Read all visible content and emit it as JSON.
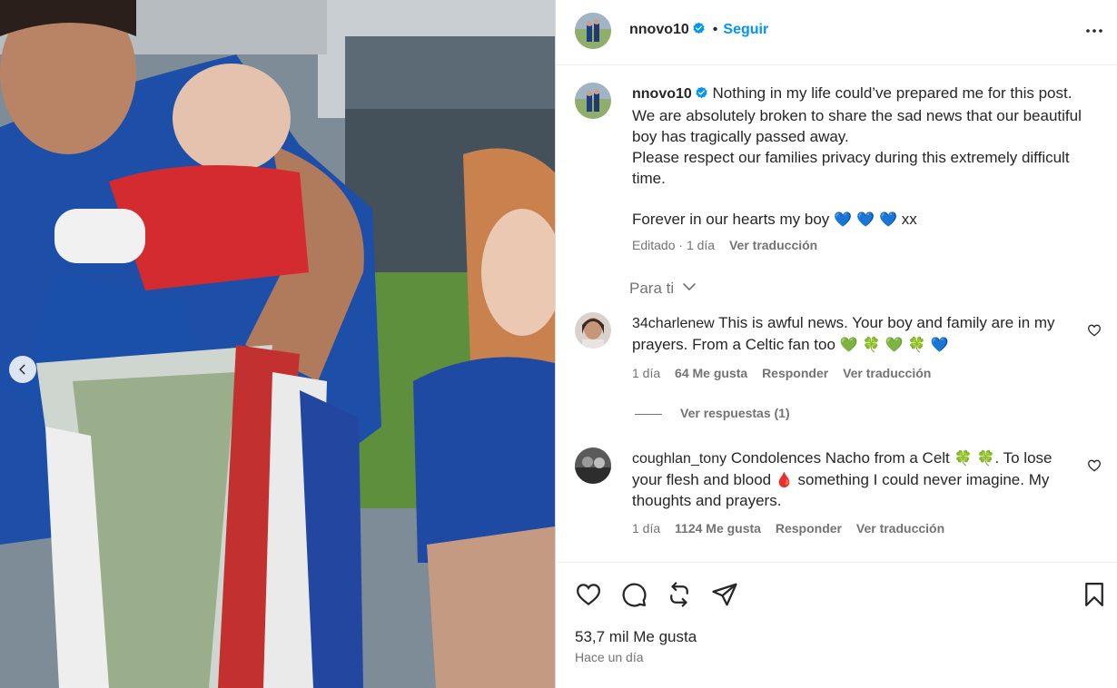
{
  "post": {
    "username": "nnovo10",
    "follow_label": "Seguir",
    "separator": "•"
  },
  "caption": {
    "username": "nnovo10",
    "text_line1": "Nothing in my life could’ve prepared me for this post. We are absolutely broken to share the sad news that our beautiful boy has tragically passed away.",
    "text_line2": "Please respect our families privacy during this extremely difficult time.",
    "text_line3": "Forever in our hearts my boy",
    "text_line3_emoji": "💙 💙 💙",
    "text_line3_suffix": "xx",
    "edited_label": "Editado",
    "edited_time": "1 día",
    "translate_label": "Ver traducción"
  },
  "filter": {
    "label": "Para ti"
  },
  "comments": [
    {
      "username": "34charlenew",
      "text": "This is awful news. Your boy and family are in my prayers. From a Celtic fan too",
      "emoji": "💚 🍀 💚 🍀  💙",
      "time": "1 día",
      "likes": "64 Me gusta",
      "reply_label": "Responder",
      "translate_label": "Ver traducción"
    },
    {
      "username": "coughlan_tony",
      "text_part1": "Condolences Nacho from a Celt",
      "emoji1": "🍀 🍀",
      "text_part2": ". To lose your flesh and blood",
      "emoji2": "🩸",
      "text_part3": "something I could never imagine. My thoughts and prayers.",
      "time": "1 día",
      "likes": "1124 Me gusta",
      "reply_label": "Responder",
      "translate_label": "Ver traducción"
    }
  ],
  "replies": {
    "label": "Ver respuestas (1)"
  },
  "footer": {
    "likes": "53,7 mil Me gusta",
    "time": "Hace un día"
  },
  "icons": {
    "like": "heart-icon",
    "comment": "comment-icon",
    "repost": "repost-icon",
    "share": "share-icon",
    "save": "bookmark-icon",
    "more": "more-icon",
    "verified": "verified-badge-icon",
    "prev": "chevron-left-icon"
  },
  "colors": {
    "accent": "#0095f6",
    "text": "#262626",
    "muted": "#737373",
    "verified": "#0095f6"
  }
}
